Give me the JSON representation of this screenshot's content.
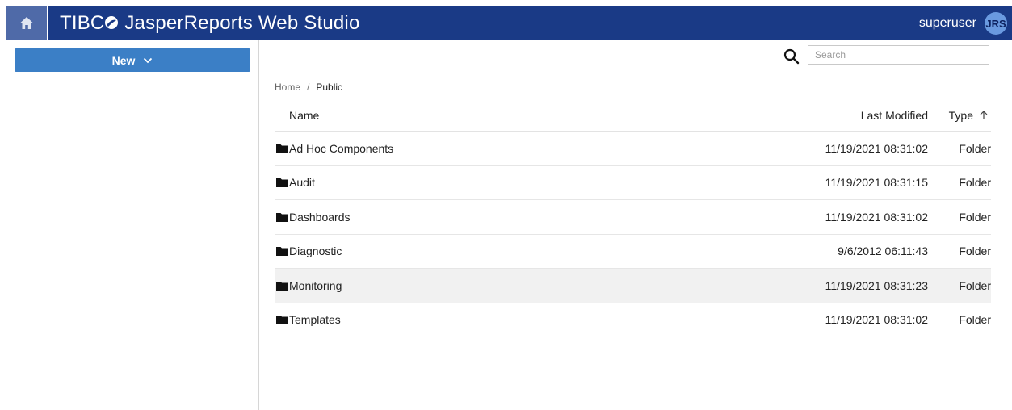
{
  "header": {
    "brand": "TIBC☢ JasperReports Web Studio",
    "brand_prefix": "TIBC",
    "brand_suffix": " JasperReports Web Studio",
    "user": "superuser",
    "avatar": "JRS",
    "bg_color": "#1a3a86"
  },
  "left": {
    "new_label": "New"
  },
  "search": {
    "placeholder": "Search"
  },
  "breadcrumb": {
    "home": "Home",
    "separator": "/",
    "current": "Public"
  },
  "table": {
    "columns": {
      "name": "Name",
      "modified": "Last Modified",
      "type": "Type"
    },
    "rows": [
      {
        "name": "Ad Hoc Components",
        "modified": "11/19/2021 08:31:02",
        "type": "Folder"
      },
      {
        "name": "Audit",
        "modified": "11/19/2021 08:31:15",
        "type": "Folder"
      },
      {
        "name": "Dashboards",
        "modified": "11/19/2021 08:31:02",
        "type": "Folder"
      },
      {
        "name": "Diagnostic",
        "modified": "9/6/2012 06:11:43",
        "type": "Folder"
      },
      {
        "name": "Monitoring",
        "modified": "11/19/2021 08:31:23",
        "type": "Folder"
      },
      {
        "name": "Templates",
        "modified": "11/19/2021 08:31:02",
        "type": "Folder"
      }
    ],
    "selected_row": "Monitoring"
  },
  "icons": [
    "home-icon",
    "tibco-logo-icon",
    "chevron-down-icon",
    "search-icon",
    "sort-up-arrow-icon",
    "folder-icon"
  ]
}
